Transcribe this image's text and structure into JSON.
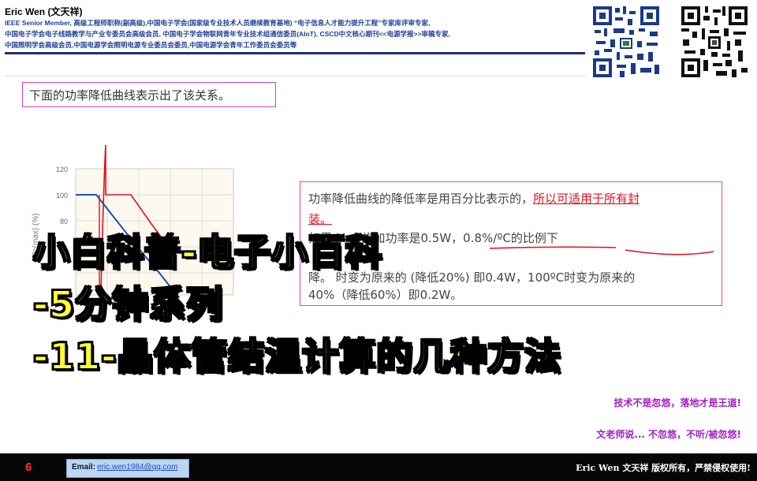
{
  "header": {
    "author": "Eric Wen (文天祥)",
    "lines": [
      "IEEE Senior Member, 高级工程师职称(副高级),中国电子学会(国家级专业技术人员继续教育基地) “电子信息人才能力提升工程”专家库评审专家,",
      "中国电子学会电子线路教学与产业专委员会高级会员, 中国电子学会物联网青年专业技术组通信委员(AIoT), CSCD中文核心期刊<<电源学报>>审稿专家,",
      "中国照明学会高级会员,中国电源学会照明电源专业委员会委员,中国电源学会青年工作委员会委员等"
    ]
  },
  "slide": {
    "intro": "下面的功率降低曲线表示出了该关系。",
    "chart": {
      "y_ticks": [
        "120",
        "100",
        "80"
      ],
      "y_label": "Pc(max) (%)"
    },
    "info_lines": [
      {
        "normal": "功率降低曲线的降低率是用百分比表示的，",
        "red": "所以可适用于所有封"
      },
      {
        "normal": "",
        "red": "装。"
      },
      {
        "normal": "如果 M             大施加功率是0.5W，0.8%/ºC的比例下",
        "red": ""
      },
      {
        "normal": "降。      时变为原来的    (降低20%) 即0.4W，100ºC时变为原来的",
        "red": ""
      },
      {
        "normal": "40%（降低60%）即0.2W。",
        "red": ""
      }
    ]
  },
  "overlay": {
    "line1": "小白科普-电子小百科",
    "line2": "-5分钟系列",
    "line3": "-11-晶体管结温计算的几种方法"
  },
  "slogans": {
    "s1": "技术不是忽悠，落地才是王道!",
    "s2": "文老师说... 不忽悠，不听/被忽悠!"
  },
  "footer": {
    "page": "6",
    "email_label": "Email:",
    "email": "eric.wen1984@qq.com",
    "copyright": "Eric Wen 文天祥 版权所有，严禁侵权使用!"
  },
  "colors": {
    "accent_magenta": "#e040c0",
    "overlay_yellow": "#ffff33",
    "curve_red": "#e01020",
    "curve_blue": "#1f4fb0",
    "header_blue": "#1f3f9a"
  }
}
